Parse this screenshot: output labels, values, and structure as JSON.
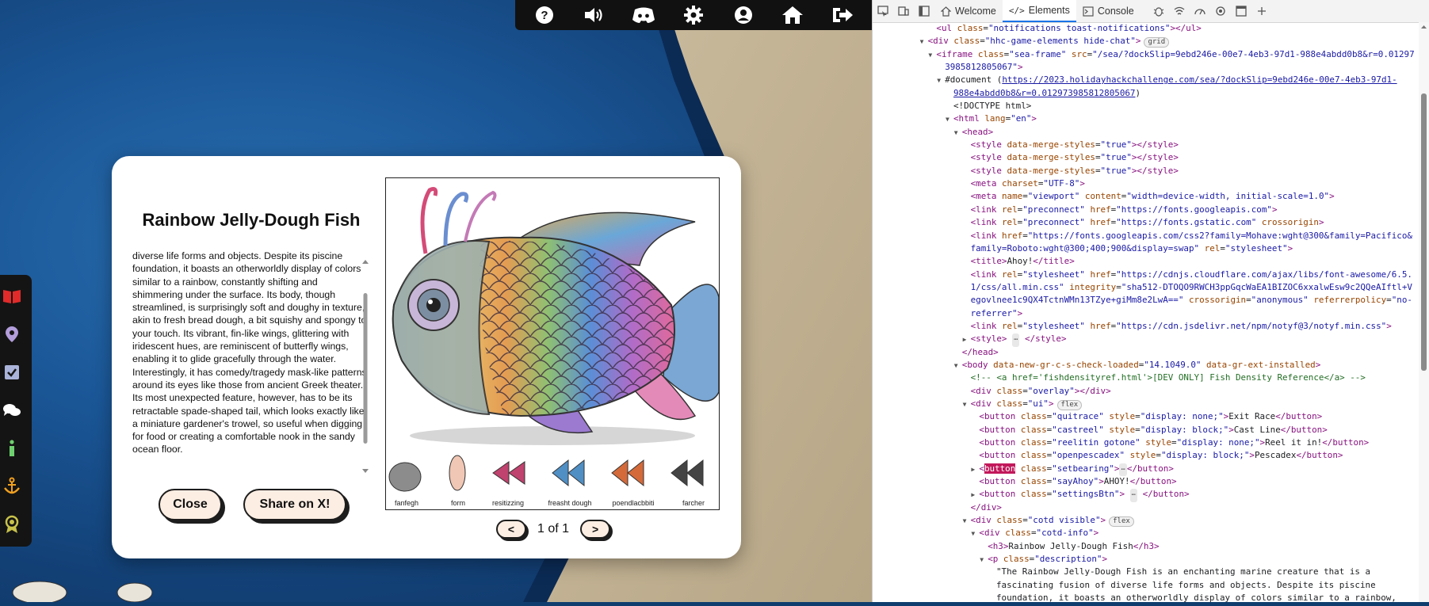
{
  "toolbar": {
    "icons": [
      "help-icon",
      "volume-icon",
      "discord-icon",
      "settings-icon",
      "profile-icon",
      "home-icon",
      "logout-icon"
    ]
  },
  "dock": {
    "icons": [
      "map-book-icon",
      "location-pin-icon",
      "checklist-icon",
      "chat-icon",
      "info-icon",
      "anchor-icon",
      "badge-icon"
    ]
  },
  "modal": {
    "title": "Rainbow Jelly-Dough Fish",
    "description": "diverse life forms and objects. Despite its piscine foundation, it boasts an otherworldly display of colors similar to a rainbow, constantly shifting and shimmering under the surface. Its body, though streamlined, is surprisingly soft and doughy in texture, akin to fresh bread dough, a bit squishy and spongy to your touch. Its vibrant, fin-like wings, glittering with iridescent hues, are reminiscent of butterfly wings, enabling it to glide gracefully through the water. Interestingly, it has comedy/tragedy mask-like patterns around its eyes like those from ancient Greek theater. Its most unexpected feature, however, has to be its retractable spade-shaped tail, which looks exactly like a miniature gardener's trowel, so useful when digging for food or creating a comfortable nook in the sandy ocean floor.",
    "close_label": "Close",
    "share_label": "Share on X!",
    "art_labels": [
      "fanfegh",
      "form",
      "resitizzing",
      "freasht dough",
      "poendlacbbiti",
      "farcher"
    ],
    "prev_label": "<",
    "next_label": ">",
    "page_label": "1 of 1"
  },
  "devtools": {
    "tabs": {
      "welcome": "Welcome",
      "elements": "Elements",
      "console": "Console"
    },
    "lines": [
      {
        "indent": 3,
        "tri": "",
        "html": "<span class='tg'>&lt;ul</span> <span class='an'>class</span>=<span class='av'>\"notifications toast-notifications\"</span><span class='tg'>&gt;&lt;/ul&gt;</span>"
      },
      {
        "indent": 2,
        "tri": "▼",
        "html": "<span class='tg'>&lt;div</span> <span class='an'>class</span>=<span class='av'>\"hhc-game-elements hide-chat\"</span><span class='tg'>&gt;</span><span class='badge'>grid</span>"
      },
      {
        "indent": 3,
        "tri": "▼",
        "html": "<span class='tg'>&lt;iframe</span> <span class='an'>class</span>=<span class='av'>\"sea-frame\"</span> <span class='an'>src</span>=<span class='av'>\"/sea/?dockSlip=9ebd246e-00e7-4eb3-97d1-988e4abdd0b8&amp;r=0.01297</span>"
      },
      {
        "indent": 4,
        "tri": "",
        "html": "<span class='av'>3985812805067\"</span><span class='tg'>&gt;</span>"
      },
      {
        "indent": 4,
        "tri": "▼",
        "html": "<span class='tx'>#document (</span><span class='lk'>https://2023.holidayhackchallenge.com/sea/?dockSlip=9ebd246e-00e7-4eb3-97d1-</span>"
      },
      {
        "indent": 5,
        "tri": "",
        "html": "<span class='lk'>988e4abdd0b8&amp;r=0.012973985812805067</span><span class='tx'>)</span>"
      },
      {
        "indent": 5,
        "tri": "",
        "html": "<span class='tx'>&lt;!DOCTYPE html&gt;</span>"
      },
      {
        "indent": 5,
        "tri": "▼",
        "html": "<span class='tg'>&lt;html</span> <span class='an'>lang</span>=<span class='av'>\"en\"</span><span class='tg'>&gt;</span>"
      },
      {
        "indent": 6,
        "tri": "▼",
        "html": "<span class='tg'>&lt;head&gt;</span>"
      },
      {
        "indent": 7,
        "tri": "",
        "html": "<span class='tg'>&lt;style</span> <span class='an'>data-merge-styles</span>=<span class='av'>\"true\"</span><span class='tg'>&gt;&lt;/style&gt;</span>"
      },
      {
        "indent": 7,
        "tri": "",
        "html": "<span class='tg'>&lt;style</span> <span class='an'>data-merge-styles</span>=<span class='av'>\"true\"</span><span class='tg'>&gt;&lt;/style&gt;</span>"
      },
      {
        "indent": 7,
        "tri": "",
        "html": "<span class='tg'>&lt;style</span> <span class='an'>data-merge-styles</span>=<span class='av'>\"true\"</span><span class='tg'>&gt;&lt;/style&gt;</span>"
      },
      {
        "indent": 7,
        "tri": "",
        "html": "<span class='tg'>&lt;meta</span> <span class='an'>charset</span>=<span class='av'>\"UTF-8\"</span><span class='tg'>&gt;</span>"
      },
      {
        "indent": 7,
        "tri": "",
        "html": "<span class='tg'>&lt;meta</span> <span class='an'>name</span>=<span class='av'>\"viewport\"</span> <span class='an'>content</span>=<span class='av'>\"width=device-width, initial-scale=1.0\"</span><span class='tg'>&gt;</span>"
      },
      {
        "indent": 7,
        "tri": "",
        "html": "<span class='tg'>&lt;link</span> <span class='an'>rel</span>=<span class='av'>\"preconnect\"</span> <span class='an'>href</span>=<span class='av'>\"https://fonts.googleapis.com\"</span><span class='tg'>&gt;</span>"
      },
      {
        "indent": 7,
        "tri": "",
        "html": "<span class='tg'>&lt;link</span> <span class='an'>rel</span>=<span class='av'>\"preconnect\"</span> <span class='an'>href</span>=<span class='av'>\"https://fonts.gstatic.com\"</span> <span class='an'>crossorigin</span><span class='tg'>&gt;</span>"
      },
      {
        "indent": 7,
        "tri": "",
        "html": "<span class='tg'>&lt;link</span> <span class='an'>href</span>=<span class='av'>\"https://fonts.googleapis.com/css2?family=Mohave:wght@300&amp;family=Pacifico&amp;</span>"
      },
      {
        "indent": 7,
        "tri": "",
        "html": "<span class='av'>family=Roboto:wght@300;400;900&amp;display=swap\"</span> <span class='an'>rel</span>=<span class='av'>\"stylesheet\"</span><span class='tg'>&gt;</span>"
      },
      {
        "indent": 7,
        "tri": "",
        "html": "<span class='tg'>&lt;title&gt;</span><span class='tx'>Ahoy!</span><span class='tg'>&lt;/title&gt;</span>"
      },
      {
        "indent": 7,
        "tri": "",
        "html": "<span class='tg'>&lt;link</span> <span class='an'>rel</span>=<span class='av'>\"stylesheet\"</span> <span class='an'>href</span>=<span class='av'>\"https://cdnjs.cloudflare.com/ajax/libs/font-awesome/6.5.</span>"
      },
      {
        "indent": 7,
        "tri": "",
        "html": "<span class='av'>1/css/all.min.css\"</span> <span class='an'>integrity</span>=<span class='av'>\"sha512-DTOQO9RWCH3ppGqcWaEA1BIZOC6xxalwEsw9c2QQeAIftl+V</span>"
      },
      {
        "indent": 7,
        "tri": "",
        "html": "<span class='av'>egovlnee1c9QX4TctnWMn13TZye+giMm8e2LwA==\"</span> <span class='an'>crossorigin</span>=<span class='av'>\"anonymous\"</span> <span class='an'>referrerpolicy</span>=<span class='av'>\"no-</span>"
      },
      {
        "indent": 7,
        "tri": "",
        "html": "<span class='av'>referrer\"</span><span class='tg'>&gt;</span>"
      },
      {
        "indent": 7,
        "tri": "",
        "html": "<span class='tg'>&lt;link</span> <span class='an'>rel</span>=<span class='av'>\"stylesheet\"</span> <span class='an'>href</span>=<span class='av'>\"https://cdn.jsdelivr.net/npm/notyf@3/notyf.min.css\"</span><span class='tg'>&gt;</span>"
      },
      {
        "indent": 7,
        "tri": "▶",
        "html": "<span class='tg'>&lt;style&gt;</span> <span class='ell'>⋯</span> <span class='tg'>&lt;/style&gt;</span>"
      },
      {
        "indent": 6,
        "tri": "",
        "html": "<span class='tg'>&lt;/head&gt;</span>"
      },
      {
        "indent": 6,
        "tri": "▼",
        "html": "<span class='tg'>&lt;body</span> <span class='an'>data-new-gr-c-s-check-loaded</span>=<span class='av'>\"14.1049.0\"</span> <span class='an'>data-gr-ext-installed</span><span class='tg'>&gt;</span>"
      },
      {
        "indent": 7,
        "tri": "",
        "html": "<span class='cm'>&lt;!-- &lt;a href='fishdensityref.html'&gt;[DEV ONLY] Fish Density Reference&lt;/a&gt; --&gt;</span>"
      },
      {
        "indent": 7,
        "tri": "",
        "html": "<span class='tg'>&lt;div</span> <span class='an'>class</span>=<span class='av'>\"overlay\"</span><span class='tg'>&gt;&lt;/div&gt;</span>"
      },
      {
        "indent": 7,
        "tri": "▼",
        "html": "<span class='tg'>&lt;div</span> <span class='an'>class</span>=<span class='av'>\"ui\"</span><span class='tg'>&gt;</span><span class='badge'>flex</span>"
      },
      {
        "indent": 8,
        "tri": "",
        "html": "<span class='tg'>&lt;button</span> <span class='an'>class</span>=<span class='av'>\"quitrace\"</span> <span class='an'>style</span>=<span class='av'>\"display: none;\"</span><span class='tg'>&gt;</span><span class='tx'>Exit Race</span><span class='tg'>&lt;/button&gt;</span>"
      },
      {
        "indent": 8,
        "tri": "",
        "html": "<span class='tg'>&lt;button</span> <span class='an'>class</span>=<span class='av'>\"castreel\"</span> <span class='an'>style</span>=<span class='av'>\"display: block;\"</span><span class='tg'>&gt;</span><span class='tx'>Cast Line</span><span class='tg'>&lt;/button&gt;</span>"
      },
      {
        "indent": 8,
        "tri": "",
        "html": "<span class='tg'>&lt;button</span> <span class='an'>class</span>=<span class='av'>\"reelitin gotone\"</span> <span class='an'>style</span>=<span class='av'>\"display: none;\"</span><span class='tg'>&gt;</span><span class='tx'>Reel it in!</span><span class='tg'>&lt;/button&gt;</span>"
      },
      {
        "indent": 8,
        "tri": "",
        "html": "<span class='tg'>&lt;button</span> <span class='an'>class</span>=<span class='av'>\"openpescadex\"</span> <span class='an'>style</span>=<span class='av'>\"display: block;\"</span><span class='tg'>&gt;</span><span class='tx'>Pescadex</span><span class='tg'>&lt;/button&gt;</span>"
      },
      {
        "indent": 8,
        "tri": "▶",
        "html": "<span class='tg'>&lt;</span><span class='sel'>button</span> <span class='an'>class</span>=<span class='av'>\"setbearing\"</span><span class='tg'>&gt;</span><span class='ell'>⋯</span><span class='tg'>&lt;/button&gt;</span>"
      },
      {
        "indent": 8,
        "tri": "",
        "html": "<span class='tg'>&lt;button</span> <span class='an'>class</span>=<span class='av'>\"sayAhoy\"</span><span class='tg'>&gt;</span><span class='tx'>AHOY!</span><span class='tg'>&lt;/button&gt;</span>"
      },
      {
        "indent": 8,
        "tri": "▶",
        "html": "<span class='tg'>&lt;button</span> <span class='an'>class</span>=<span class='av'>\"settingsBtn\"</span><span class='tg'>&gt;</span> <span class='ell'>⋯</span> <span class='tg'>&lt;/button&gt;</span>"
      },
      {
        "indent": 7,
        "tri": "",
        "html": "<span class='tg'>&lt;/div&gt;</span>"
      },
      {
        "indent": 7,
        "tri": "▼",
        "html": "<span class='tg'>&lt;div</span> <span class='an'>class</span>=<span class='av'>\"cotd visible\"</span><span class='tg'>&gt;</span><span class='badge'>flex</span>"
      },
      {
        "indent": 8,
        "tri": "▼",
        "html": "<span class='tg'>&lt;div</span> <span class='an'>class</span>=<span class='av'>\"cotd-info\"</span><span class='tg'>&gt;</span>"
      },
      {
        "indent": 9,
        "tri": "",
        "html": "<span class='tg'>&lt;h3&gt;</span><span class='tx'>Rainbow Jelly-Dough Fish</span><span class='tg'>&lt;/h3&gt;</span>"
      },
      {
        "indent": 9,
        "tri": "▼",
        "html": "<span class='tg'>&lt;p</span> <span class='an'>class</span>=<span class='av'>\"description\"</span><span class='tg'>&gt;</span>"
      },
      {
        "indent": 10,
        "tri": "",
        "html": "<span class='tx'>\"The Rainbow Jelly-Dough Fish is an enchanting marine creature that is a</span>"
      },
      {
        "indent": 10,
        "tri": "",
        "html": "<span class='tx'>fascinating fusion of diverse life forms and objects. Despite its piscine</span>"
      },
      {
        "indent": 10,
        "tri": "",
        "html": "<span class='tx'>foundation, it boasts an otherworldly display of colors similar to a rainbow,</span>"
      }
    ]
  }
}
